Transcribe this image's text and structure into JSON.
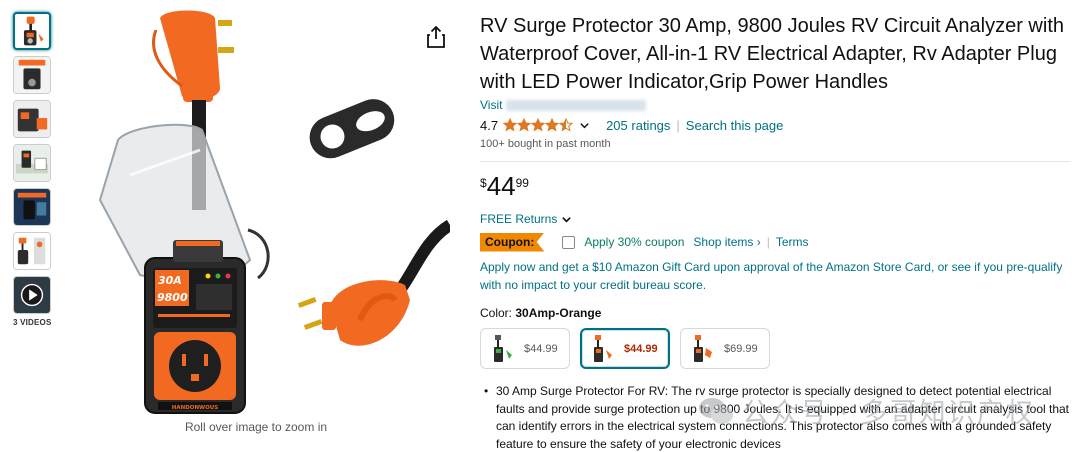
{
  "thumbnails": [
    {
      "kind": "orange",
      "active": true
    },
    {
      "kind": "dark-card",
      "active": false
    },
    {
      "kind": "closeup",
      "active": false
    },
    {
      "kind": "rv-scene",
      "active": false
    },
    {
      "kind": "blue-card",
      "active": false
    },
    {
      "kind": "white-diagram",
      "active": false
    },
    {
      "kind": "video",
      "active": false
    }
  ],
  "videos_label": "3 VIDEOS",
  "zoom_hint": "Roll over image to zoom in",
  "main_image": {
    "device_amp": "30A",
    "device_joules": "9800",
    "device_brand": "HANDONWOUS"
  },
  "product": {
    "title": "RV Surge Protector 30 Amp, 9800 Joules RV Circuit Analyzer with Waterproof Cover, All-in-1 RV Electrical Adapter, Rv Adapter Plug with LED Power Indicator,Grip Power Handles",
    "visit_prefix": "Visit",
    "rating": "4.7",
    "stars_filled": 4.5,
    "ratings_count": "205 ratings",
    "search_page": "Search this page",
    "bought": "100+ bought in past month"
  },
  "price": {
    "currency": "$",
    "whole": "44",
    "fraction": "99"
  },
  "returns": "FREE Returns",
  "coupon": {
    "badge": "Coupon:",
    "text": "Apply 30% coupon",
    "shop_items": "Shop items ›",
    "separator": "|",
    "terms": "Terms"
  },
  "apply_text": "Apply now and get a $10 Amazon Gift Card upon approval of the Amazon Store Card, or see if you pre-qualify with no impact to your credit bureau score.",
  "color": {
    "label": "Color:",
    "value": "30Amp-Orange"
  },
  "swatches": [
    {
      "price": "$44.99",
      "selected": false,
      "accent": "#3cb043"
    },
    {
      "price": "$44.99",
      "selected": true,
      "accent": "#f26a21"
    },
    {
      "price": "$69.99",
      "selected": false,
      "accent": "#f26a21"
    }
  ],
  "bullets": [
    "30 Amp Surge Protector For RV: The rv surge protector is specially designed to detect potential electrical faults and provide surge protection up to 9800 Joules. It is equipped with an adapter circuit analysis tool that can identify errors in the electrical system connections. This protector also comes with a grounded safety feature to ensure the safety of your electronic devices"
  ],
  "watermark": "公众号 · 多哥知识产权",
  "colors": {
    "link": "#007185",
    "orange": "#f26a21",
    "coupon_badge": "#f08804",
    "star": "#de7921",
    "price_red": "#b12704"
  }
}
